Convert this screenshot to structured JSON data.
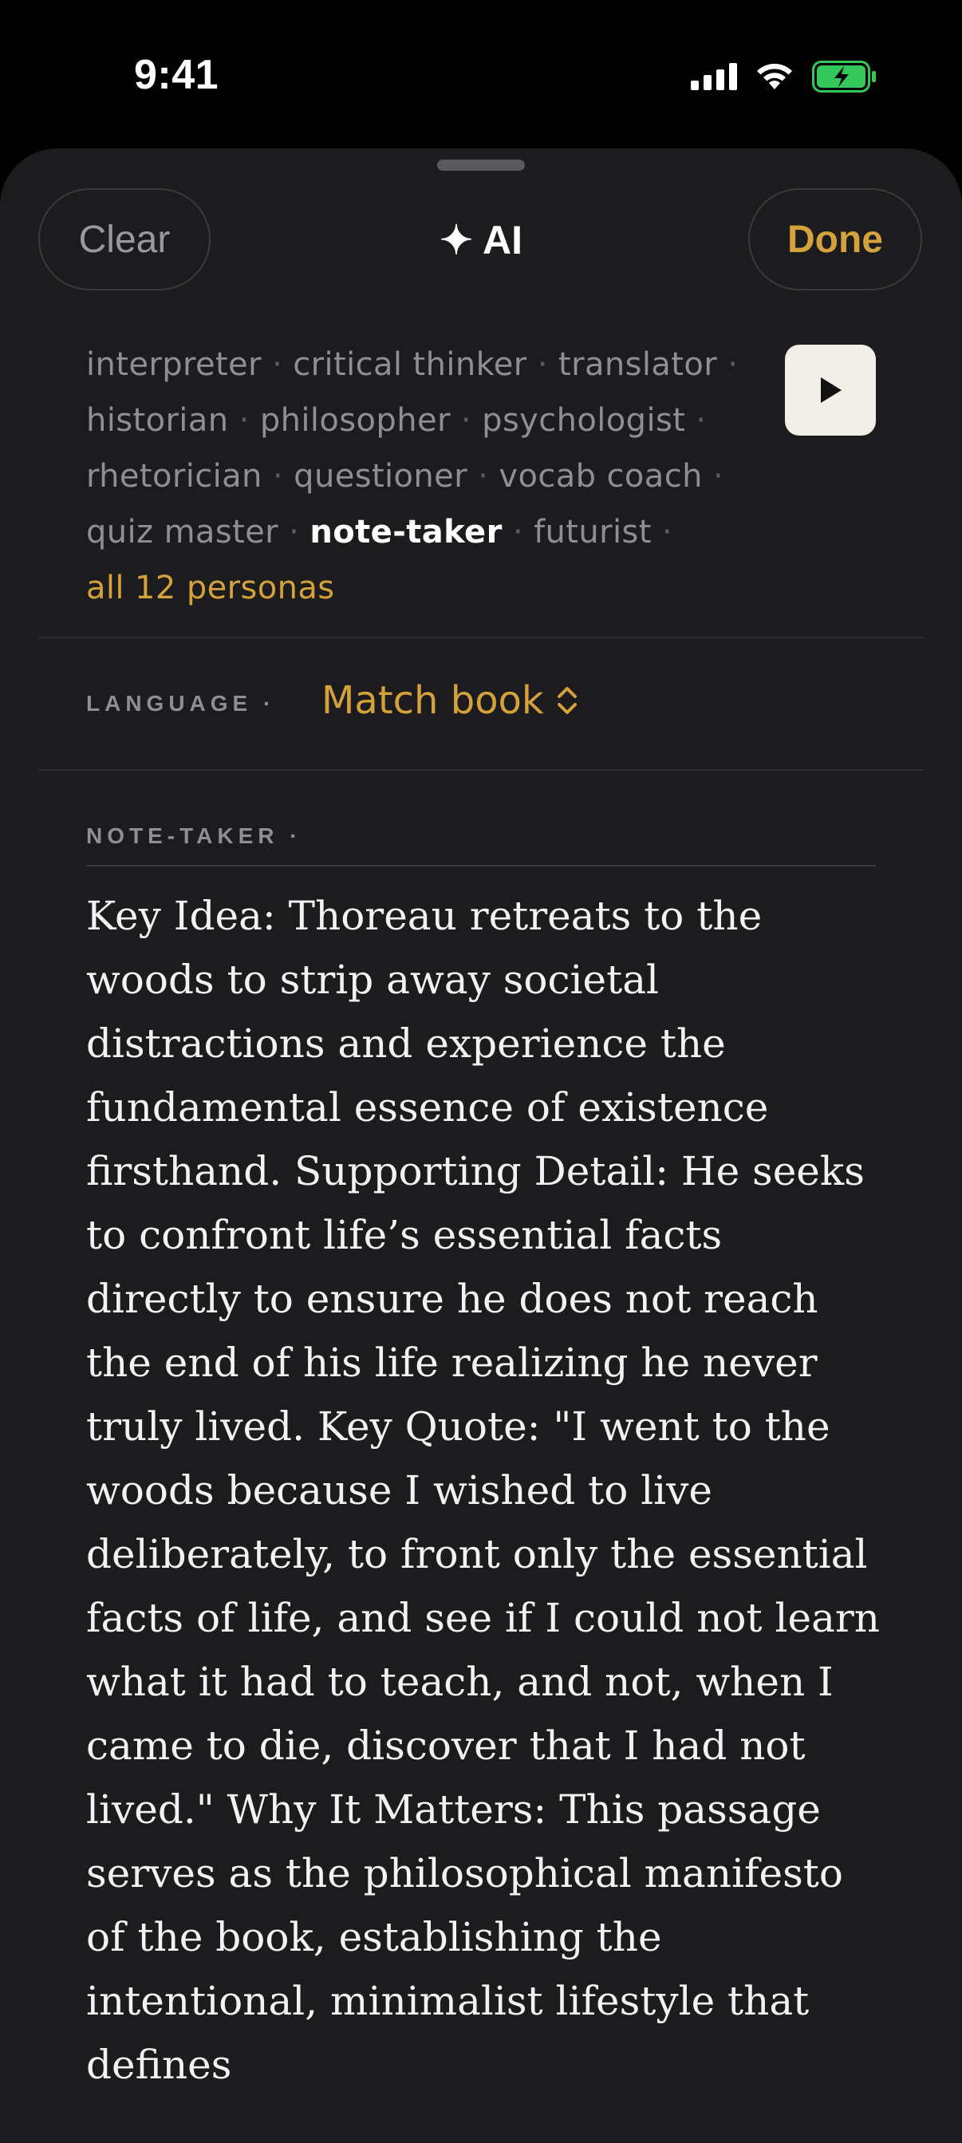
{
  "status": {
    "time": "9:41"
  },
  "header": {
    "clear_label": "Clear",
    "title": "✦ AI",
    "done_label": "Done"
  },
  "personas": {
    "rows": [
      [
        {
          "label": "interpreter"
        },
        {
          "label": "critical thinker"
        },
        {
          "label": "translator"
        }
      ],
      [
        {
          "label": "historian"
        },
        {
          "label": "philosopher"
        },
        {
          "label": "psychologist"
        }
      ],
      [
        {
          "label": "rhetorician"
        },
        {
          "label": "questioner"
        },
        {
          "label": "vocab coach"
        }
      ],
      [
        {
          "label": "quiz master"
        },
        {
          "label": "note-taker",
          "active": true
        },
        {
          "label": "futurist"
        }
      ]
    ],
    "separator": "·",
    "all_label": "all 12 personas"
  },
  "language": {
    "label": "LANGUAGE ·",
    "value": "Match book"
  },
  "note": {
    "label": "NOTE-TAKER ·",
    "text": "Key Idea: Thoreau retreats to the woods to strip away societal distractions and experience the fundamental essence of existence firsthand. Supporting Detail: He seeks to confront life’s essential facts directly to ensure he does not reach the end of his life realizing he never truly lived. Key Quote: \"I went to the woods because I wished to live deliberately, to front only the essential facts of life, and see if I could not learn what it had to teach, and not, when I came to die, discover that I had not lived.\" Why It Matters: This passage serves as the philosophical manifesto of the book, establishing the intentional, minimalist lifestyle that defines"
  },
  "colors": {
    "accent": "#d4a13a",
    "sheet": "#1c1c1e",
    "battery": "#34c759"
  }
}
